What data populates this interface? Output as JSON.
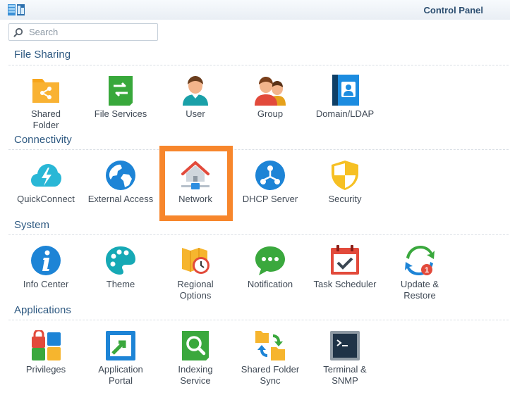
{
  "window": {
    "title": "Control Panel"
  },
  "search": {
    "placeholder": "Search"
  },
  "sections": [
    {
      "title": "File Sharing",
      "items": [
        {
          "label": "Shared\nFolder",
          "icon": "shared-folder-icon"
        },
        {
          "label": "File Services",
          "icon": "file-services-icon"
        },
        {
          "label": "User",
          "icon": "user-icon"
        },
        {
          "label": "Group",
          "icon": "group-icon"
        },
        {
          "label": "Domain/LDAP",
          "icon": "domain-ldap-icon"
        }
      ]
    },
    {
      "title": "Connectivity",
      "items": [
        {
          "label": "QuickConnect",
          "icon": "quickconnect-icon"
        },
        {
          "label": "External Access",
          "icon": "external-access-icon"
        },
        {
          "label": "Network",
          "icon": "network-icon"
        },
        {
          "label": "DHCP Server",
          "icon": "dhcp-server-icon"
        },
        {
          "label": "Security",
          "icon": "security-icon"
        }
      ]
    },
    {
      "title": "System",
      "items": [
        {
          "label": "Info Center",
          "icon": "info-center-icon"
        },
        {
          "label": "Theme",
          "icon": "theme-icon"
        },
        {
          "label": "Regional\nOptions",
          "icon": "regional-options-icon"
        },
        {
          "label": "Notification",
          "icon": "notification-icon"
        },
        {
          "label": "Task Scheduler",
          "icon": "task-scheduler-icon"
        },
        {
          "label": "Update &\nRestore",
          "icon": "update-restore-icon",
          "badge": "1"
        }
      ]
    },
    {
      "title": "Applications",
      "items": [
        {
          "label": "Privileges",
          "icon": "privileges-icon"
        },
        {
          "label": "Application\nPortal",
          "icon": "application-portal-icon"
        },
        {
          "label": "Indexing\nService",
          "icon": "indexing-service-icon"
        },
        {
          "label": "Shared Folder\nSync",
          "icon": "shared-folder-sync-icon"
        },
        {
          "label": "Terminal &\nSNMP",
          "icon": "terminal-snmp-icon"
        }
      ]
    }
  ],
  "colors": {
    "title_text": "#2c4e70",
    "section_text": "#2f5a82",
    "label_text": "#404a56",
    "highlight_border": "#f7862c"
  }
}
